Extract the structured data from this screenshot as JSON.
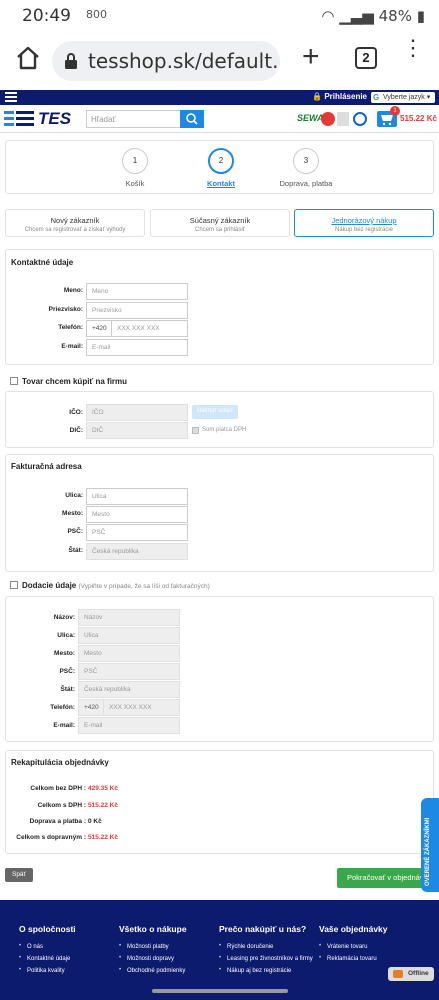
{
  "status_bar": {
    "time": "20:49",
    "speed": "800",
    "battery": "48%"
  },
  "browser": {
    "url": "tesshop.sk/default.asp",
    "tab_count": "2"
  },
  "topbar": {
    "login": "Prihlásenie",
    "language": "Vyberte jazyk"
  },
  "header": {
    "logo_text": "TES",
    "search_placeholder": "Hľadať",
    "cart_count": "1",
    "cart_total": "515.22 Kč",
    "badge_sewa": "SEWA"
  },
  "steps": [
    {
      "num": "1",
      "label": "Košík"
    },
    {
      "num": "2",
      "label": "Kontakt"
    },
    {
      "num": "3",
      "label": "Doprava, platba"
    }
  ],
  "customer_types": [
    {
      "title": "Nový zákazník",
      "subtitle": "Chcem sa registrovať a získať výhody"
    },
    {
      "title": "Súčasný zákazník",
      "subtitle": "Chcem sa prihlásiť"
    },
    {
      "title": "Jednorázový nákup",
      "subtitle": "Nákup bez registrácie"
    }
  ],
  "contact": {
    "title": "Kontaktné údaje",
    "name_label": "Meno:",
    "name_ph": "Meno",
    "surname_label": "Priezvisko:",
    "surname_ph": "Priezvisko",
    "phone_label": "Telefón:",
    "phone_prefix": "+420",
    "phone_ph": "XXX XXX XXX",
    "email_label": "E-mail:",
    "email_ph": "E-mail"
  },
  "company": {
    "title": "Tovar chcem kúpiť na firmu",
    "ico_label": "IČO:",
    "ico_ph": "IČO",
    "load_btn": "Načítať údaje",
    "dic_label": "DIČ:",
    "dic_ph": "DIČ",
    "vat_payer": "Som platca DPH"
  },
  "billing": {
    "title": "Fakturačná adresa",
    "street_label": "Ulica:",
    "street_ph": "Ulica",
    "city_label": "Mesto:",
    "city_ph": "Mesto",
    "zip_label": "PSČ:",
    "zip_ph": "PSČ",
    "country_label": "Štát:",
    "country_value": "Česká republika"
  },
  "delivery": {
    "title": "Dodacie údaje",
    "note": "(Vyplňte v prípade, že sa líši od fakturačných)",
    "name_label": "Názov:",
    "name_ph": "Názov",
    "street_label": "Ulica:",
    "street_ph": "Ulica",
    "city_label": "Mesto:",
    "city_ph": "Mesto",
    "zip_label": "PSČ:",
    "zip_ph": "PSČ",
    "country_label": "Štát:",
    "country_value": "Česká republika",
    "phone_label": "Telefón:",
    "phone_prefix": "+420",
    "phone_ph": "XXX XXX XXX",
    "email_label": "E-mail:",
    "email_ph": "E-mail"
  },
  "summary": {
    "title": "Rekapitulácia objednávky",
    "rows": [
      {
        "label": "Celkom bez DPH :",
        "value": "429.35 Kč"
      },
      {
        "label": "Celkom s DPH :",
        "value": "515.22 Kč"
      },
      {
        "label": "Doprava a platba :",
        "value": "0 Kč"
      },
      {
        "label": "Celkom  s dopravným :",
        "value": "515.22 Kč"
      }
    ]
  },
  "actions": {
    "back": "Späť",
    "next": "Pokračovať v objednávaní"
  },
  "side_tab": "OVERENÉ ZÁKAZNÍKMI",
  "footer": {
    "columns": [
      {
        "title": "O spoločnosti",
        "items": [
          "O nás",
          "Kontaktné údaje",
          "Politika kvality"
        ]
      },
      {
        "title": "Všetko o nákupe",
        "items": [
          "Možnosti platby",
          "Možnosti dopravy",
          "Obchodné podmienky"
        ]
      },
      {
        "title": "Prečo nakúpiť u nás?",
        "items": [
          "Rýchle doručenie",
          "Leasing pre živnostníkov a firmy",
          "Nákup aj bez registrácie"
        ]
      },
      {
        "title": "Vaše objednávky",
        "items": [
          "Vrátenie tovaru",
          "Reklamácia tovaru"
        ]
      }
    ],
    "offline": "Offline"
  },
  "colors": {
    "navy": "#0d1b6e",
    "accent": "#1e88e5",
    "price": "#e53935",
    "next": "#3aa84a"
  }
}
